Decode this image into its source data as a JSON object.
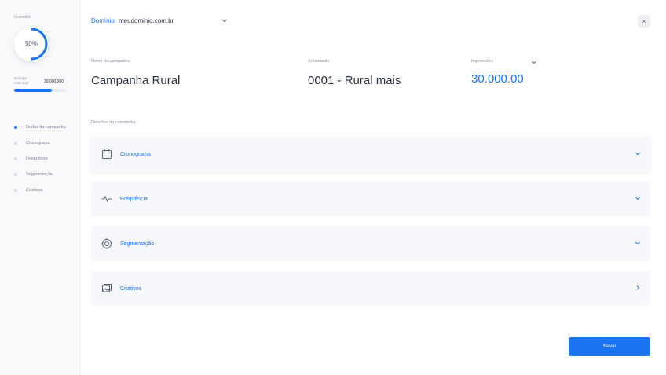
{
  "sidebar": {
    "inventory_label": "Inventário",
    "gauge_text": "50%",
    "gauge_fraction": 0.5,
    "delivery_label": "Entrega estimada",
    "delivery_value": "30.000.000",
    "delivery_progress": 0.72,
    "steps": [
      {
        "label": "Dados da campanha",
        "active": true
      },
      {
        "label": "Cronograma",
        "active": false
      },
      {
        "label": "Frequência",
        "active": false
      },
      {
        "label": "Segmentação",
        "active": false
      },
      {
        "label": "Criativos",
        "active": false
      }
    ]
  },
  "header": {
    "domain_key": "Domínio:",
    "domain_value": "meudominio.com.br",
    "close_symbol": "×"
  },
  "summary": {
    "name_label": "Nome da campanha",
    "name_value": "Campanha Rural",
    "advertiser_label": "Anunciante",
    "advertiser_value": "0001 - Rural mais",
    "impressions_label": "Impressões",
    "impressions_value": "30.000.00"
  },
  "details": {
    "section_label": "Detalhes da campanha",
    "items": [
      {
        "title": "Cronograma",
        "icon": "calendar-icon"
      },
      {
        "title": "Frequência",
        "icon": "pulse-icon"
      },
      {
        "title": "Segmentação",
        "icon": "target-icon"
      },
      {
        "title": "Criativos",
        "icon": "images-icon"
      }
    ]
  },
  "actions": {
    "save_label": "Salvar"
  },
  "colors": {
    "accent": "#1a73f0",
    "sidebar_bg": "#f9f9fb",
    "card_bg": "#f7f8fb"
  }
}
